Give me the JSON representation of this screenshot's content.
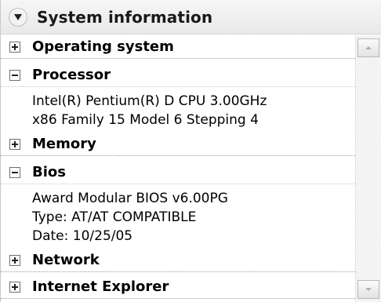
{
  "header": {
    "title": "System information",
    "icon": "chevron-down-icon"
  },
  "sections": {
    "os": {
      "label": "Operating system",
      "expanded": false
    },
    "processor": {
      "label": "Processor",
      "expanded": true,
      "lines": [
        "Intel(R) Pentium(R) D CPU 3.00GHz",
        "x86 Family 15 Model 6 Stepping 4"
      ]
    },
    "memory": {
      "label": "Memory",
      "expanded": false
    },
    "bios": {
      "label": "Bios",
      "expanded": true,
      "lines": [
        "Award Modular BIOS v6.00PG",
        "Type:  AT/AT COMPATIBLE",
        "Date:  10/25/05"
      ]
    },
    "network": {
      "label": "Network",
      "expanded": false
    },
    "ie": {
      "label": "Internet Explorer",
      "expanded": false
    }
  },
  "scrollbar": {
    "up_icon": "scroll-up-arrow-icon",
    "down_icon": "scroll-down-arrow-icon"
  }
}
